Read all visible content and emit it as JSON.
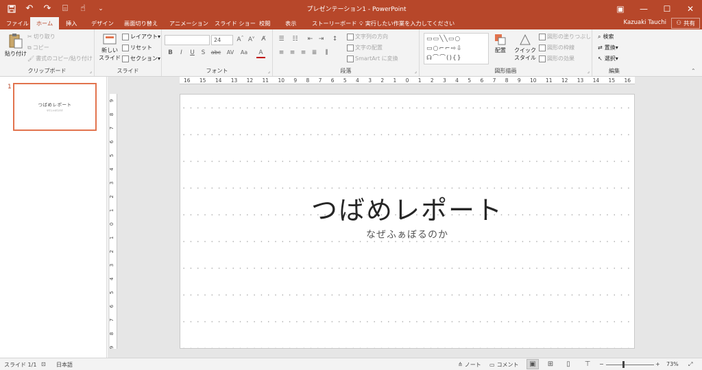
{
  "titlebar": {
    "title": "プレゼンテーション1 - PowerPoint",
    "qat_icons": [
      "save-icon",
      "undo-icon",
      "redo-icon",
      "present-icon",
      "touch-mode-icon",
      "customize-icon"
    ],
    "controls": {
      "ribbon_options": "▣",
      "minimize": "—",
      "maximize": "☐",
      "close": "✕"
    }
  },
  "tabs": [
    {
      "label": "ファイル",
      "active": false
    },
    {
      "label": "ホーム",
      "active": true
    },
    {
      "label": "挿入",
      "active": false
    },
    {
      "label": "デザイン",
      "active": false
    },
    {
      "label": "画面切り替え",
      "active": false
    },
    {
      "label": "アニメーション",
      "active": false
    },
    {
      "label": "スライド ショー",
      "active": false
    },
    {
      "label": "校閲",
      "active": false
    },
    {
      "label": "表示",
      "active": false
    },
    {
      "label": "ストーリーボード",
      "active": false
    }
  ],
  "tell_me": "実行したい作業を入力してください",
  "user": "Kazuaki Tauchi",
  "share": "共有",
  "ribbon": {
    "clipboard": {
      "paste": "貼り付け",
      "cut": "切り取り",
      "copy": "コピー",
      "format_painter": "書式のコピー/貼り付け",
      "label": "クリップボード"
    },
    "slides": {
      "new_slide": "新しい",
      "new_slide_2": "スライド",
      "layout": "レイアウト",
      "reset": "リセット",
      "section": "セクション",
      "label": "スライド"
    },
    "font": {
      "font_name": "",
      "font_size": "24",
      "label": "フォント",
      "row2": [
        "B",
        "I",
        "U",
        "S",
        "abc",
        "AV",
        "Aa",
        "A"
      ]
    },
    "paragraph": {
      "text_direction": "文字列の方向",
      "align_text": "文字の配置",
      "smartart": "SmartArt に変換",
      "label": "段落"
    },
    "drawing": {
      "arrange": "配置",
      "quick_styles": "クイック",
      "quick_styles_2": "スタイル",
      "fill": "図形の塗りつぶし",
      "outline": "図形の枠線",
      "effects": "図形の効果",
      "label": "図形描画"
    },
    "editing": {
      "find": "検索",
      "replace": "置換",
      "select": "選択",
      "label": "編集"
    }
  },
  "slides_pane": {
    "slide_number": "1",
    "thumb_title": "つばめレポート",
    "thumb_sub": "なぜふぁぼるのか"
  },
  "slide": {
    "title": "つばめレポート",
    "subtitle": "なぜふぁぼるのか"
  },
  "ruler": {
    "horizontal": [
      "16",
      "15",
      "14",
      "13",
      "12",
      "11",
      "10",
      "9",
      "8",
      "7",
      "6",
      "5",
      "4",
      "3",
      "2",
      "1",
      "0",
      "1",
      "2",
      "3",
      "4",
      "5",
      "6",
      "7",
      "8",
      "9",
      "10",
      "11",
      "12",
      "13",
      "14",
      "15",
      "16"
    ],
    "vertical": [
      "9",
      "8",
      "7",
      "6",
      "5",
      "4",
      "3",
      "2",
      "1",
      "0",
      "1",
      "2",
      "3",
      "4",
      "5",
      "6",
      "7",
      "8",
      "9"
    ]
  },
  "status": {
    "slide": "スライド 1/1",
    "language": "日本語",
    "notes": "ノート",
    "comments": "コメント",
    "zoom": "73%"
  }
}
